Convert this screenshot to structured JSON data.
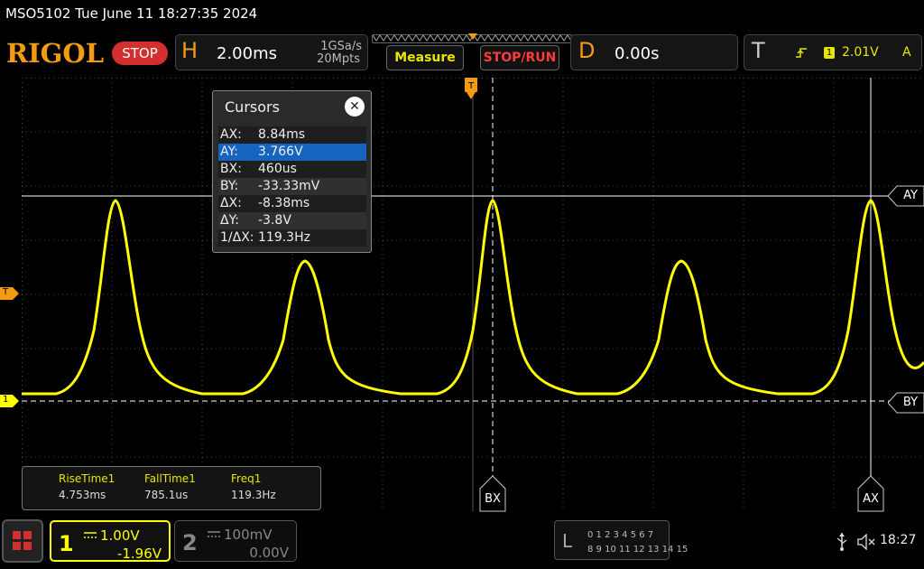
{
  "title_bar": {
    "text": "MSO5102  Tue June 11 18:27:35 2024"
  },
  "header": {
    "logo": "RIGOL",
    "run_state": "STOP",
    "horizontal": {
      "letter": "H",
      "timebase": "2.00ms",
      "sample_rate": "1GSa/s",
      "memory_depth": "20Mpts"
    },
    "measure_button": "Measure",
    "stop_run_button": "STOP/RUN",
    "delay": {
      "letter": "D",
      "value": "0.00s"
    },
    "trigger": {
      "letter": "T",
      "channel": "1",
      "level": "2.01V",
      "mode": "A"
    }
  },
  "markers": {
    "trigger_top": "T",
    "trigger_level": "T",
    "channel1_ground": "1"
  },
  "cursors": {
    "title": "Cursors",
    "close": "✕",
    "rows": [
      {
        "key": "AX:",
        "value": "8.84ms"
      },
      {
        "key": "AY:",
        "value": "3.766V",
        "selected": true
      },
      {
        "key": "BX:",
        "value": "460us"
      },
      {
        "key": "BY:",
        "value": "-33.33mV"
      },
      {
        "key": "ΔX:",
        "value": "-8.38ms"
      },
      {
        "key": "ΔY:",
        "value": "-3.8V"
      },
      {
        "key": "1/ΔX:",
        "value": "119.3Hz"
      }
    ],
    "tags": {
      "AY": "AY",
      "BY": "BY",
      "BX": "BX",
      "AX": "AX"
    }
  },
  "measurements": [
    {
      "name": "RiseTime1",
      "value": "4.753ms"
    },
    {
      "name": "FallTime1",
      "value": "785.1us"
    },
    {
      "name": "Freq1",
      "value": "119.3Hz"
    }
  ],
  "bottom": {
    "ch1": {
      "number": "1",
      "scale": "1.00V",
      "offset": "-1.96V",
      "color": "#ffff00"
    },
    "ch2": {
      "number": "2",
      "scale": "100mV",
      "offset": "0.00V",
      "color": "#888888"
    },
    "la": {
      "letter": "L",
      "row1": "0 1 2 3  4 5 6 7",
      "row2": "8 9 10 11 12 13 14 15"
    },
    "usb_icon": "usb-icon",
    "speaker_icon": "speaker-muted-icon",
    "time": "18:27"
  },
  "colors": {
    "accent": "#f39c12",
    "ch1": "#ffff00",
    "stop": "#d32f2f",
    "selected_row": "#1565c0"
  }
}
